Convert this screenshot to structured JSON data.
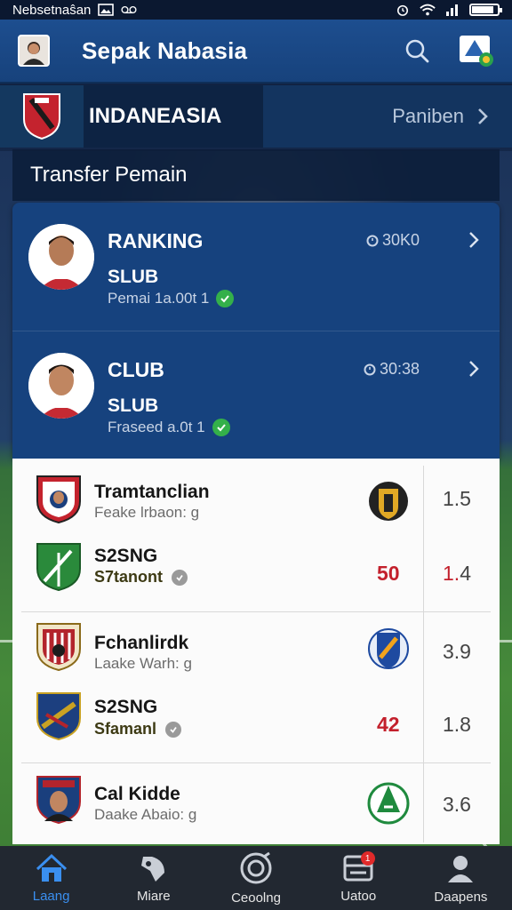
{
  "status_bar": {
    "carrier": "Nebsetnaŝan",
    "icons": [
      "gallery-icon",
      "voicemail-icon",
      "alarm-icon",
      "wifi-icon",
      "signal-icon",
      "battery-icon"
    ],
    "battery_level": 0.85
  },
  "header": {
    "title": "Sepak Nabasia",
    "icons": [
      "avatar",
      "search-icon",
      "notification-icon"
    ]
  },
  "league": {
    "name": "INDANEASIA",
    "link_label": "Paniben"
  },
  "section": {
    "title": "Transfer Pemain"
  },
  "ranking": [
    {
      "title": "RANKING",
      "club": "SLUB",
      "sub": "Pemai 1a.00t 1",
      "time": "30K0",
      "verified": true
    },
    {
      "title": "CLUB",
      "club": "SLUB",
      "sub": "Fraseed a.0t 1",
      "time": "30:38",
      "verified": true
    }
  ],
  "transfers": [
    {
      "name": "Tramtanclian",
      "sub": "Feake lrbaon: g",
      "rate": "1.5",
      "crest_color": "#c4232e",
      "logo_color": "#d9a21f"
    },
    {
      "name": "S2SNG",
      "sub": "S7tanont",
      "value": "50",
      "rate": "1.4",
      "rate_prefix": "1.",
      "rate_suffix": "4",
      "crest_color": "#2a8a3b"
    },
    {
      "name": "Fchanlirdk",
      "sub": "Laake Warh: g",
      "rate": "3.9",
      "crest_color": "#b3242c",
      "logo_color": "#1e4aa0"
    },
    {
      "name": "S2SNG",
      "sub": "Sfamanl",
      "value": "42",
      "rate": "1.8",
      "crest_color": "#1c3f7f"
    },
    {
      "name": "Cal Kidde",
      "sub": "Daake Abaio: g",
      "rate": "3.6",
      "crest_color": "#1a3f7d",
      "logo_color": "#1f8a3e"
    }
  ],
  "bottom_nav": [
    {
      "label": "Laang",
      "icon": "home-icon",
      "active": true
    },
    {
      "label": "Miare",
      "icon": "stats-icon",
      "active": false
    },
    {
      "label": "Ceoolng",
      "icon": "ball-icon",
      "active": false
    },
    {
      "label": "Uatoo",
      "icon": "inbox-icon",
      "active": false,
      "badge": "1"
    },
    {
      "label": "Daapens",
      "icon": "profile-icon",
      "active": false
    }
  ],
  "colors": {
    "header_bg": "#1d4e8f",
    "card_bg": "#16427e",
    "accent_red": "#c3202c",
    "accent_green": "#34b04a",
    "nav_active": "#3a8ff0"
  }
}
